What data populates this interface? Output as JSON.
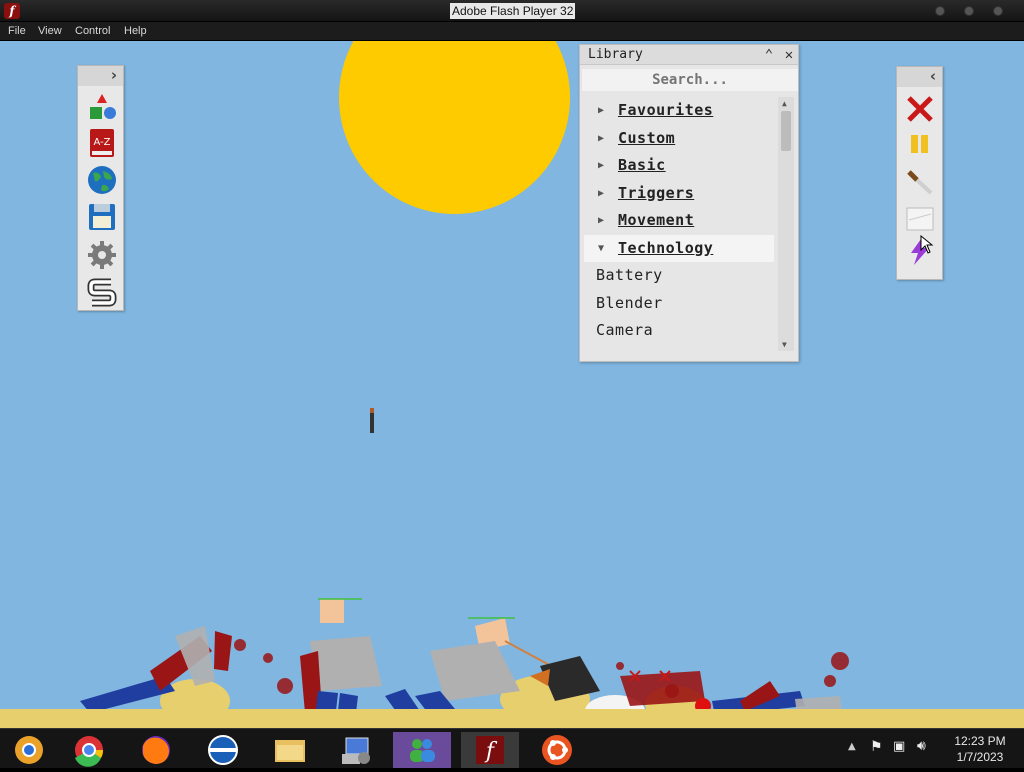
{
  "window": {
    "title": "Adobe Flash Player 32"
  },
  "menu": [
    "File",
    "View",
    "Control",
    "Help"
  ],
  "left_toolbar": {
    "expand": "›",
    "tools": [
      "spawn-shapes-icon",
      "a-z-book-icon",
      "globe-icon",
      "floppy-disk-icon",
      "gear-icon",
      "s-logo-icon"
    ],
    "a_z_label": "A-Z"
  },
  "right_toolbar": {
    "collapse": "‹",
    "tools": [
      "delete-x-icon",
      "pause-icon",
      "knife-icon",
      "glass-pane-icon",
      "lightning-icon"
    ]
  },
  "library": {
    "title": "Library",
    "search_placeholder": "Search...",
    "categories": [
      {
        "label": "Favourites",
        "expanded": false
      },
      {
        "label": "Custom ",
        "expanded": false
      },
      {
        "label": "Basic",
        "expanded": false
      },
      {
        "label": "Triggers",
        "expanded": false
      },
      {
        "label": "Movement ",
        "expanded": false
      },
      {
        "label": "Technology",
        "expanded": true
      }
    ],
    "items": [
      "Battery",
      "Blender",
      "Camera"
    ]
  },
  "taskbar": {
    "apps": [
      "chrome-canary-icon",
      "chrome-icon",
      "firefox-icon",
      "opera-icon",
      "file-explorer-icon",
      "control-panel-icon",
      "windows-live-messenger-icon",
      "flash-player-icon",
      "ubuntu-icon"
    ],
    "active": "flash-player-icon"
  },
  "clock": {
    "time": "12:23 PM",
    "date": "1/7/2023"
  },
  "colors": {
    "sky": "#80b6e0",
    "sun": "#fdcb00",
    "sand": "#e8cf6e",
    "blood": "#9a1515",
    "clothes_blue": "#1f3ea0",
    "body_grey": "#b0b0b0"
  }
}
